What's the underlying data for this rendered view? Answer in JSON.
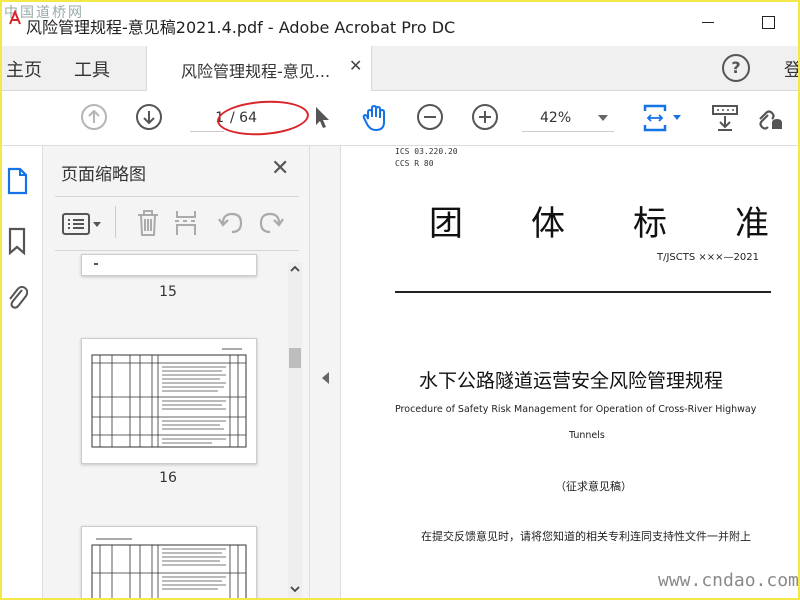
{
  "window": {
    "title": "风险管理规程-意见稿2021.4.pdf - Adobe Acrobat Pro DC",
    "watermark_top": "中国道桥网"
  },
  "tabs": {
    "home": "主页",
    "tools": "工具",
    "document": "风险管理规程-意见...",
    "login_partial": "登"
  },
  "toolbar": {
    "current_page": "1",
    "page_total": "/ 64",
    "zoom": "42%"
  },
  "thumbnail_panel": {
    "title": "页面缩略图",
    "pages": [
      "15",
      "16"
    ]
  },
  "document": {
    "ics": "ICS 03.220.20",
    "ccs": "CCS R 80",
    "standard_chars": [
      "团",
      "体",
      "标",
      "准"
    ],
    "standard_number": "T/JSCTS ×××—2021",
    "title_cn": "水下公路隧道运营安全风险管理规程",
    "title_en_1": "Procedure of Safety Risk Management for Operation of Cross-River Highway",
    "title_en_2": "Tunnels",
    "draft": "（征求意见稿）",
    "note": "在提交反馈意见时，请将您知道的相关专利连同支持性文件一并附上"
  },
  "watermark_bottom": "www.cndao.com",
  "colors": {
    "accent_blue": "#1473e6",
    "annotation_red": "#d9252a",
    "frame_yellow": "#f2e84a"
  }
}
